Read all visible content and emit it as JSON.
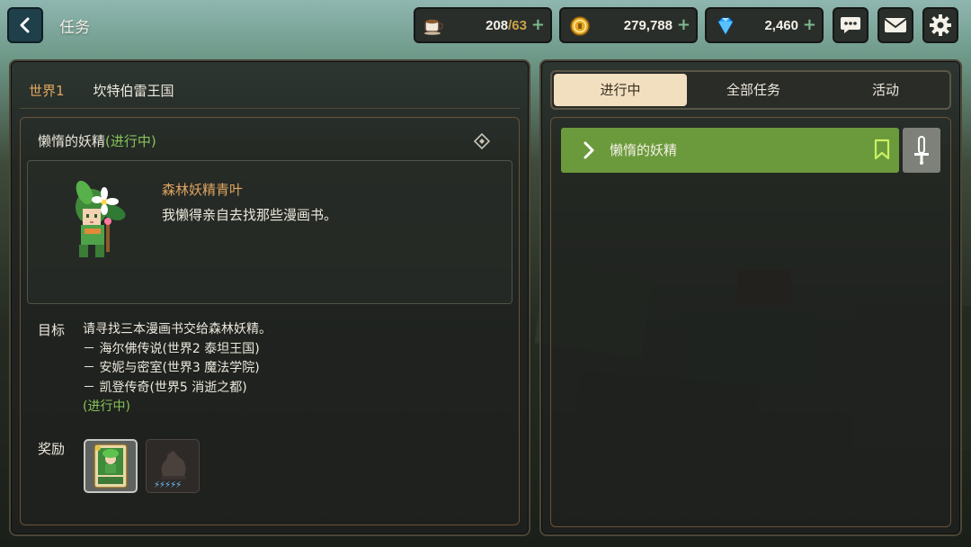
{
  "header": {
    "title": "任务",
    "resources": [
      {
        "icon": "coffee-cup-icon",
        "value": "208",
        "sub": "/63"
      },
      {
        "icon": "gold-coin-icon",
        "value": "279,788",
        "sub": ""
      },
      {
        "icon": "blue-diamond-icon",
        "value": "2,460",
        "sub": ""
      }
    ],
    "plus": "+"
  },
  "left_panel": {
    "world": "世界1",
    "kingdom": "坎特伯雷王国",
    "quest_name": "懒惰的妖精",
    "quest_status": "(进行中)",
    "npc": {
      "name": "森林妖精青叶",
      "line": "我懒得亲自去找那些漫画书。"
    },
    "objective_label": "目标",
    "objective_text": "请寻找三本漫画书交给森林妖精。",
    "objective_items": [
      "－ 海尔佛传说(世界2  泰坦王国)",
      "－ 安妮与密室(世界3  魔法学院)",
      "－ 凯登传奇(世界5  消逝之都)"
    ],
    "objective_status": "(进行中)",
    "reward_label": "奖励",
    "rewards": [
      {
        "icon": "hero-card-icon"
      },
      {
        "icon": "locked-item-icon",
        "stars": "⚡⚡⚡⚡⚡"
      }
    ]
  },
  "right_panel": {
    "tabs": [
      "进行中",
      "全部任务",
      "活动"
    ],
    "active_tab": 0,
    "quests": [
      {
        "label": "懒惰的妖精"
      }
    ]
  },
  "colors": {
    "accent_orange": "#e0a561",
    "status_green": "#86c35a",
    "row_green": "#6b9a3c",
    "tab_active": "#f1dfc0"
  }
}
